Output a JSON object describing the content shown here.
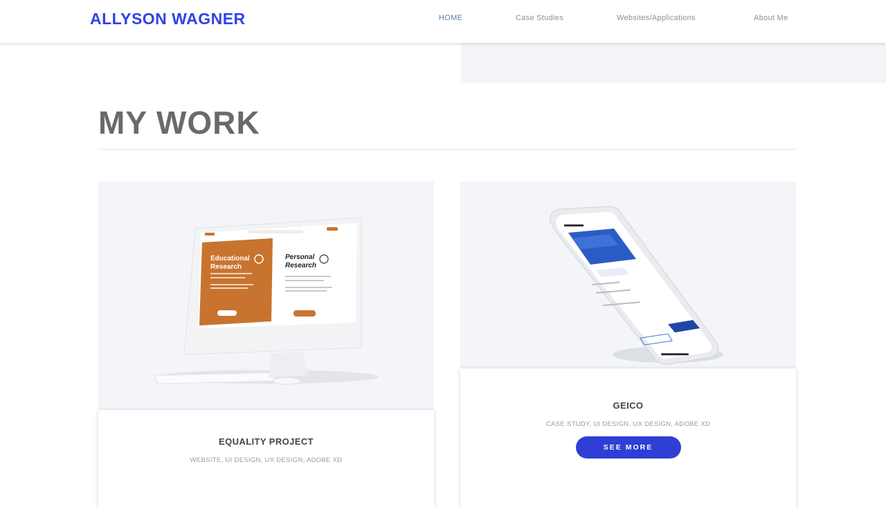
{
  "header": {
    "logo": "ALLYSON WAGNER",
    "nav": [
      {
        "label": "HOME",
        "active": true
      },
      {
        "label": "Case Studies",
        "active": false
      },
      {
        "label": "Websites/Applications",
        "active": false
      },
      {
        "label": "About Me",
        "active": false
      }
    ]
  },
  "main": {
    "title": "MY WORK",
    "projects": [
      {
        "title": "EQUALITY PROJECT",
        "tags": "WEBSITE, UI DESIGN, UX DESIGN, ADOBE XD",
        "mockup": {
          "left_heading": "Educational Research",
          "right_heading": "Personal Research"
        }
      },
      {
        "title": "GEICO",
        "tags": "CASE STUDY, UI DESIGN, UX DESIGN, ADOBE XD",
        "button": "SEE MORE"
      }
    ]
  },
  "colors": {
    "brand": "#3043e6",
    "button": "#2f3fd6",
    "mockup_orange": "#c8742f",
    "card_bg": "#f4f5f8"
  }
}
